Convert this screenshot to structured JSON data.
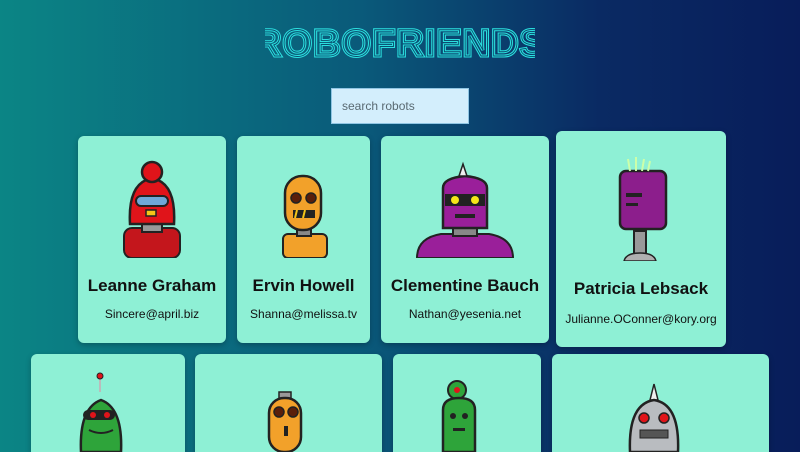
{
  "app": {
    "title": "ROBOFRIENDS"
  },
  "search": {
    "placeholder": "search robots",
    "value": ""
  },
  "robots": [
    {
      "name": "Leanne Graham",
      "email": "Sincere@april.biz",
      "color": "#e0141a"
    },
    {
      "name": "Ervin Howell",
      "email": "Shanna@melissa.tv",
      "color": "#f2a12a"
    },
    {
      "name": "Clementine Bauch",
      "email": "Nathan@yesenia.net",
      "color": "#9a1f9a"
    },
    {
      "name": "Patricia Lebsack",
      "email": "Julianne.OConner@kory.org",
      "color": "#8c1e8c"
    },
    {
      "name": "",
      "email": "",
      "color": "#2ea43a"
    },
    {
      "name": "",
      "email": "",
      "color": "#f2a12a"
    },
    {
      "name": "",
      "email": "",
      "color": "#2ea43a"
    },
    {
      "name": "",
      "email": "",
      "color": "#b9bcc0"
    }
  ],
  "colors": {
    "card_bg": "#8ef0d5",
    "title": "#2be0e0",
    "search_bg": "#d3eefc"
  }
}
